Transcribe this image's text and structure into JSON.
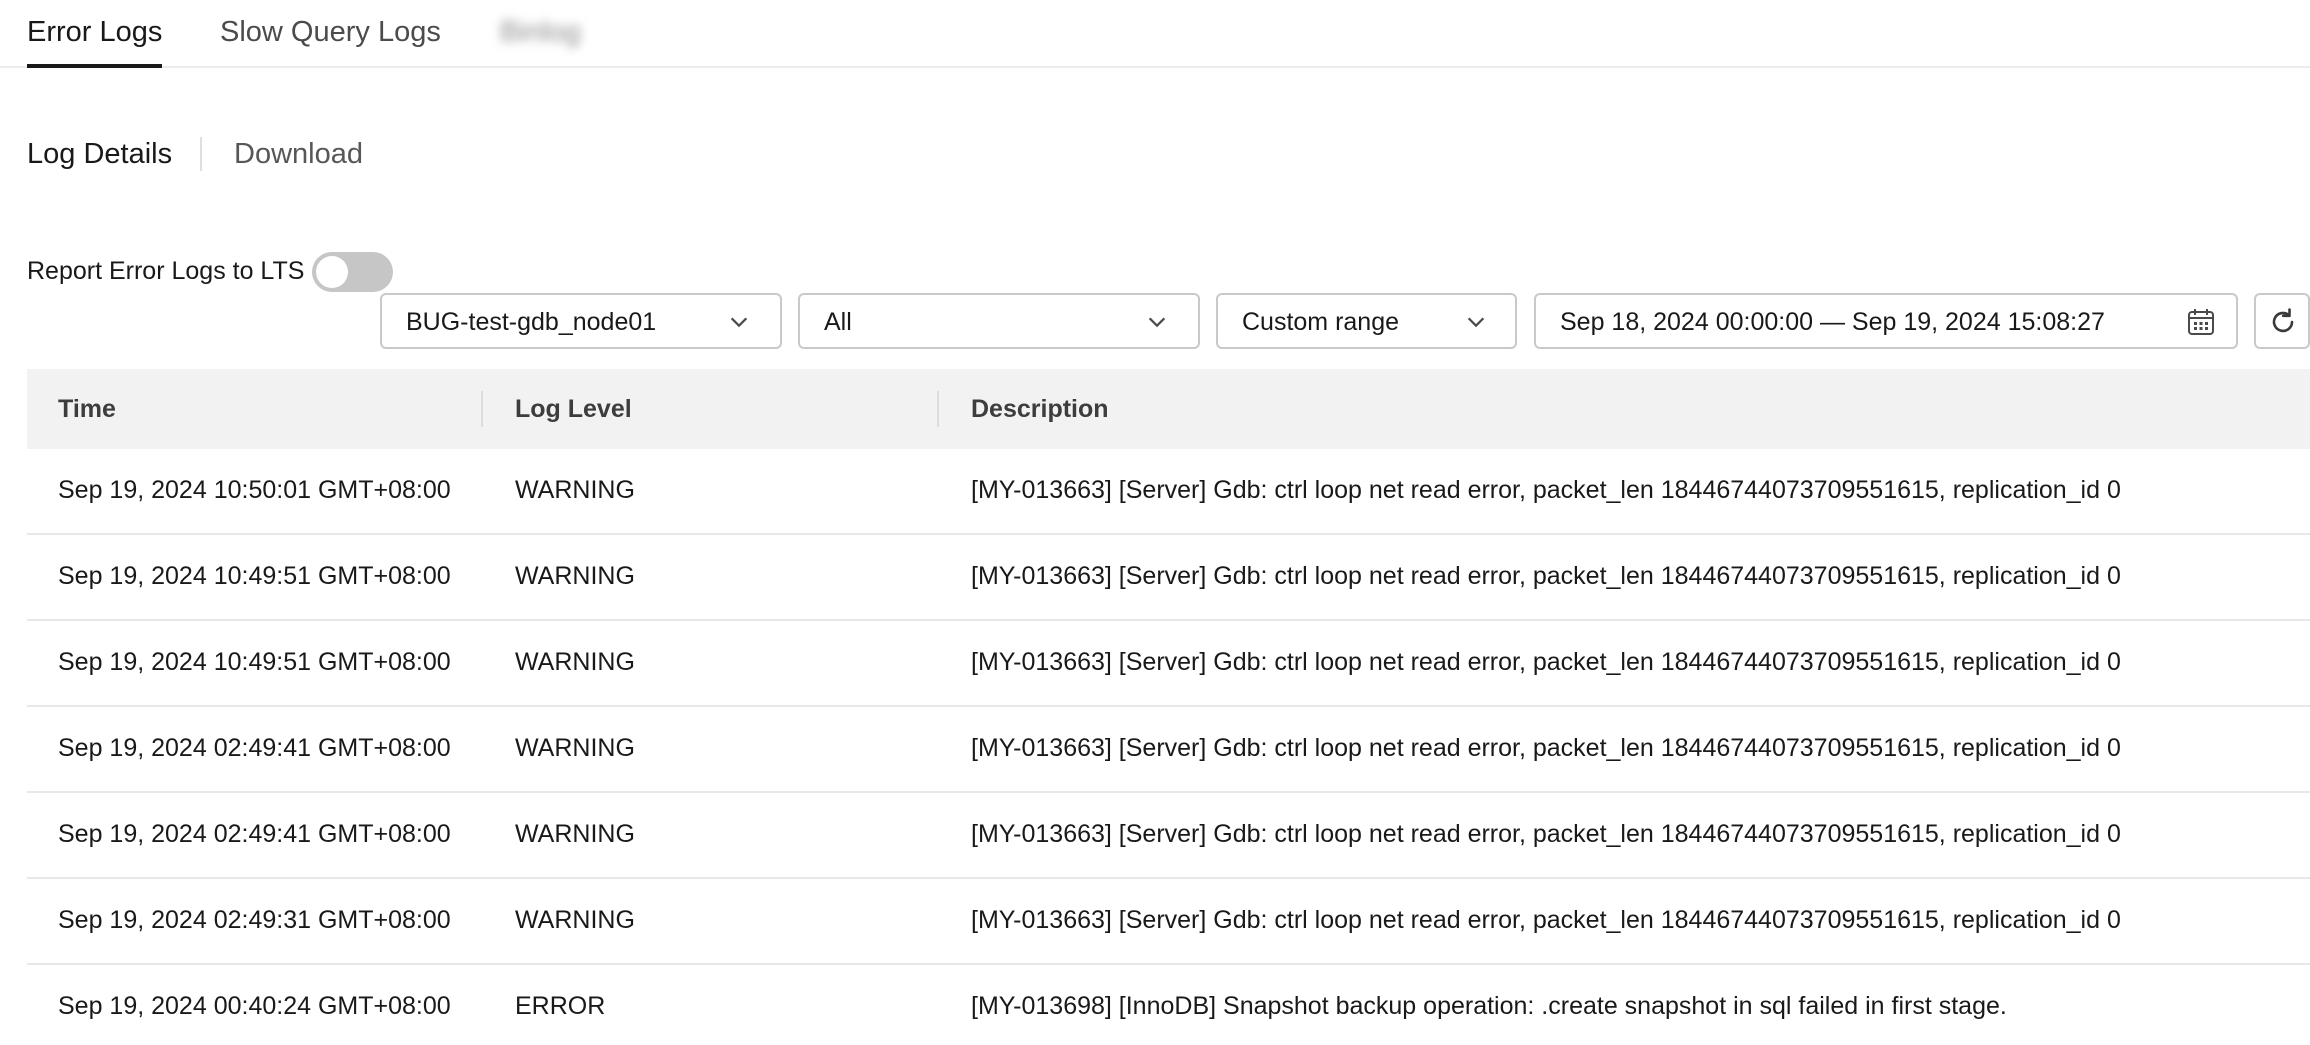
{
  "top_tabs": [
    {
      "label": "Error Logs",
      "active": true
    },
    {
      "label": "Slow Query Logs",
      "active": false
    },
    {
      "label": "Binlog",
      "active": false
    }
  ],
  "sub_tabs": [
    {
      "label": "Log Details",
      "active": true
    },
    {
      "label": "Download",
      "active": false
    }
  ],
  "report": {
    "label": "Report Error Logs to LTS",
    "enabled": false
  },
  "filters": {
    "node": "BUG-test-gdb_node01",
    "level": "All",
    "range_type": "Custom range",
    "date_range": "Sep 18, 2024 00:00:00 — Sep 19, 2024 15:08:27",
    "calendar_icon": "calendar-icon",
    "refresh_icon": "refresh-icon"
  },
  "table": {
    "columns": [
      "Time",
      "Log Level",
      "Description"
    ],
    "rows": [
      {
        "time": "Sep 19, 2024 10:50:01 GMT+08:00",
        "level": "WARNING",
        "description": "[MY-013663] [Server] Gdb: ctrl loop net read error, packet_len 18446744073709551615, replication_id 0"
      },
      {
        "time": "Sep 19, 2024 10:49:51 GMT+08:00",
        "level": "WARNING",
        "description": "[MY-013663] [Server] Gdb: ctrl loop net read error, packet_len 18446744073709551615, replication_id 0"
      },
      {
        "time": "Sep 19, 2024 10:49:51 GMT+08:00",
        "level": "WARNING",
        "description": "[MY-013663] [Server] Gdb: ctrl loop net read error, packet_len 18446744073709551615, replication_id 0"
      },
      {
        "time": "Sep 19, 2024 02:49:41 GMT+08:00",
        "level": "WARNING",
        "description": "[MY-013663] [Server] Gdb: ctrl loop net read error, packet_len 18446744073709551615, replication_id 0"
      },
      {
        "time": "Sep 19, 2024 02:49:41 GMT+08:00",
        "level": "WARNING",
        "description": "[MY-013663] [Server] Gdb: ctrl loop net read error, packet_len 18446744073709551615, replication_id 0"
      },
      {
        "time": "Sep 19, 2024 02:49:31 GMT+08:00",
        "level": "WARNING",
        "description": "[MY-013663] [Server] Gdb: ctrl loop net read error, packet_len 18446744073709551615, replication_id 0"
      },
      {
        "time": "Sep 19, 2024 00:40:24 GMT+08:00",
        "level": "ERROR",
        "description": "[MY-013698] [InnoDB] Snapshot backup operation: .create snapshot in sql failed in first stage."
      }
    ]
  }
}
